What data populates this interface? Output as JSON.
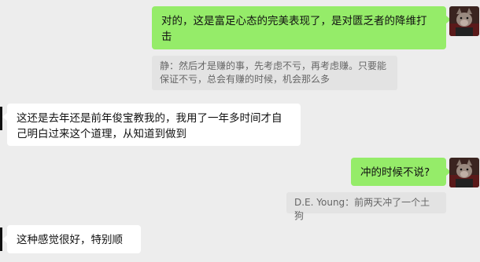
{
  "messages": [
    {
      "sender": "self",
      "text": "对的，这是富足心态的完美表现了，是对匮乏者的降维打击"
    },
    {
      "sender": "self_quote",
      "text": "静：然后才是赚的事，先考虑不亏，再考虑赚。只要能保证不亏，总会有赚的时候，机会那么多"
    },
    {
      "sender": "other",
      "text": "这还是去年还是前年俊宝教我的，我用了一年多时间才自己明白过来这个道理，从知道到做到"
    },
    {
      "sender": "self",
      "text": "冲的时候不说?"
    },
    {
      "sender": "self_quote",
      "text": "D.E. Young：前两天冲了一个土狗"
    },
    {
      "sender": "other",
      "text": "这种感觉很好，特别顺"
    }
  ],
  "colors": {
    "background": "#ededed",
    "self_bubble": "#95ec69",
    "other_bubble": "#ffffff",
    "quote_bg": "#e3e3e3"
  },
  "icons": {
    "avatar_self": "wolf-avatar-icon"
  }
}
